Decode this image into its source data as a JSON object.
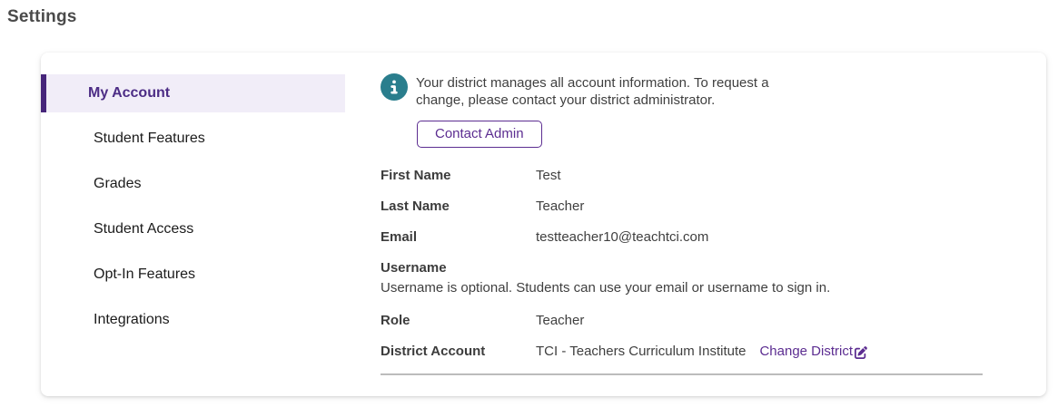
{
  "page": {
    "title": "Settings"
  },
  "sidebar": {
    "items": [
      {
        "label": "My Account",
        "active": true
      },
      {
        "label": "Student Features",
        "active": false
      },
      {
        "label": "Grades",
        "active": false
      },
      {
        "label": "Student Access",
        "active": false
      },
      {
        "label": "Opt-In Features",
        "active": false
      },
      {
        "label": "Integrations",
        "active": false
      }
    ]
  },
  "main": {
    "notice": {
      "icon": "info-circle-icon",
      "icon_color": "#2a7e8d",
      "text": "Your district manages all account information. To request a change, please contact your district administrator."
    },
    "contact_admin_label": "Contact Admin",
    "fields": [
      {
        "label": "First Name",
        "value": "Test"
      },
      {
        "label": "Last Name",
        "value": "Teacher"
      },
      {
        "label": "Email",
        "value": "testteacher10@teachtci.com"
      },
      {
        "label": "Username",
        "value": "",
        "helper": "Username is optional. Students can use your email or username to sign in."
      },
      {
        "label": "Role",
        "value": "Teacher"
      },
      {
        "label": "District Account",
        "value": "TCI - Teachers Curriculum Institute",
        "link_label": "Change District",
        "link_icon": "edit-icon"
      }
    ],
    "colors": {
      "accent_purple": "#5c2d91",
      "active_bar_purple": "#46257a",
      "active_bg": "#f1edf8",
      "info_teal": "#2a7e8d",
      "text_dark": "#3f3f3f"
    }
  }
}
